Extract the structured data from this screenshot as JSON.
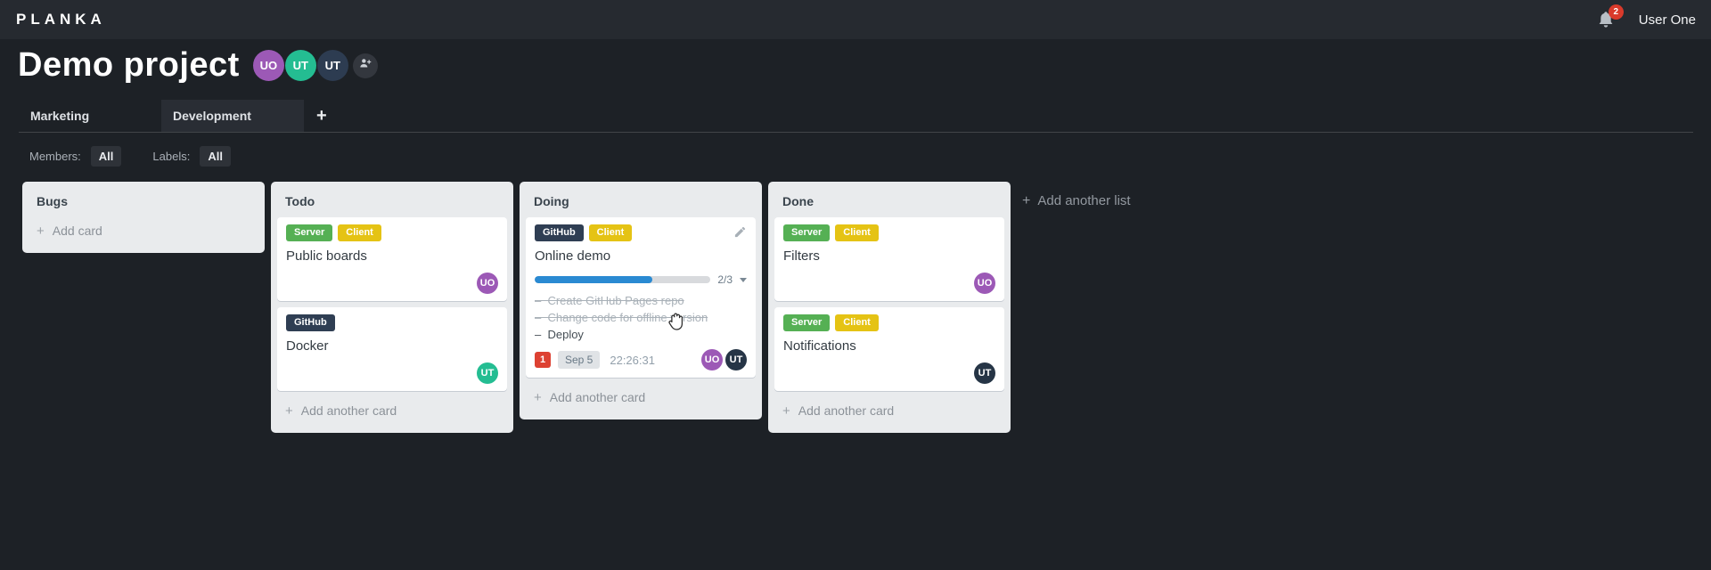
{
  "header": {
    "logo": "PLANKA",
    "notification_count": "2",
    "user_name": "User One"
  },
  "project": {
    "title": "Demo project",
    "members": [
      {
        "initials": "UO",
        "color": "#9c59b6"
      },
      {
        "initials": "UT",
        "color": "#24bd92"
      },
      {
        "initials": "UT",
        "color": "#2d3c51"
      }
    ]
  },
  "tabs": [
    {
      "label": "Marketing",
      "active": false
    },
    {
      "label": "Development",
      "active": true
    }
  ],
  "tabs_add_label": "+",
  "filters": {
    "members_label": "Members:",
    "members_value": "All",
    "labels_label": "Labels:",
    "labels_value": "All"
  },
  "board": {
    "add_list_label": "Add another list",
    "lists": [
      {
        "name": "Bugs",
        "add_label": "Add card",
        "cards": []
      },
      {
        "name": "Todo",
        "add_label": "Add another card",
        "cards": [
          {
            "labels": [
              {
                "text": "Server",
                "color": "#55b054"
              },
              {
                "text": "Client",
                "color": "#e5c314"
              }
            ],
            "title": "Public boards",
            "avatars": [
              {
                "initials": "UO",
                "color": "#9c59b6"
              }
            ]
          },
          {
            "labels": [
              {
                "text": "GitHub",
                "color": "#2f3e53"
              }
            ],
            "title": "Docker",
            "avatars": [
              {
                "initials": "UT",
                "color": "#24bd92"
              }
            ]
          }
        ]
      },
      {
        "name": "Doing",
        "add_label": "Add another card",
        "cards": [
          {
            "labels": [
              {
                "text": "GitHub",
                "color": "#2f3e53"
              },
              {
                "text": "Client",
                "color": "#e5c314"
              }
            ],
            "title": "Online demo",
            "has_edit_icon": true,
            "progress": {
              "value": 2,
              "total": 3,
              "label": "2/3",
              "percent": 66.7,
              "color": "#2a8ad2"
            },
            "tasks": [
              {
                "text": "Create GitHub Pages repo",
                "done": true
              },
              {
                "text": "Change code for offline version",
                "done": true
              },
              {
                "text": "Deploy",
                "done": false
              }
            ],
            "badges": {
              "notifications": "1",
              "due_date": "Sep 5",
              "timer": "22:26:31"
            },
            "avatars": [
              {
                "initials": "UO",
                "color": "#9c59b6"
              },
              {
                "initials": "UT",
                "color": "#263546"
              }
            ]
          }
        ]
      },
      {
        "name": "Done",
        "add_label": "Add another card",
        "cards": [
          {
            "labels": [
              {
                "text": "Server",
                "color": "#55b054"
              },
              {
                "text": "Client",
                "color": "#e5c314"
              }
            ],
            "title": "Filters",
            "avatars": [
              {
                "initials": "UO",
                "color": "#9c59b6"
              }
            ]
          },
          {
            "labels": [
              {
                "text": "Server",
                "color": "#55b054"
              },
              {
                "text": "Client",
                "color": "#e5c314"
              }
            ],
            "title": "Notifications",
            "avatars": [
              {
                "initials": "UT",
                "color": "#263546"
              }
            ]
          }
        ]
      }
    ]
  }
}
